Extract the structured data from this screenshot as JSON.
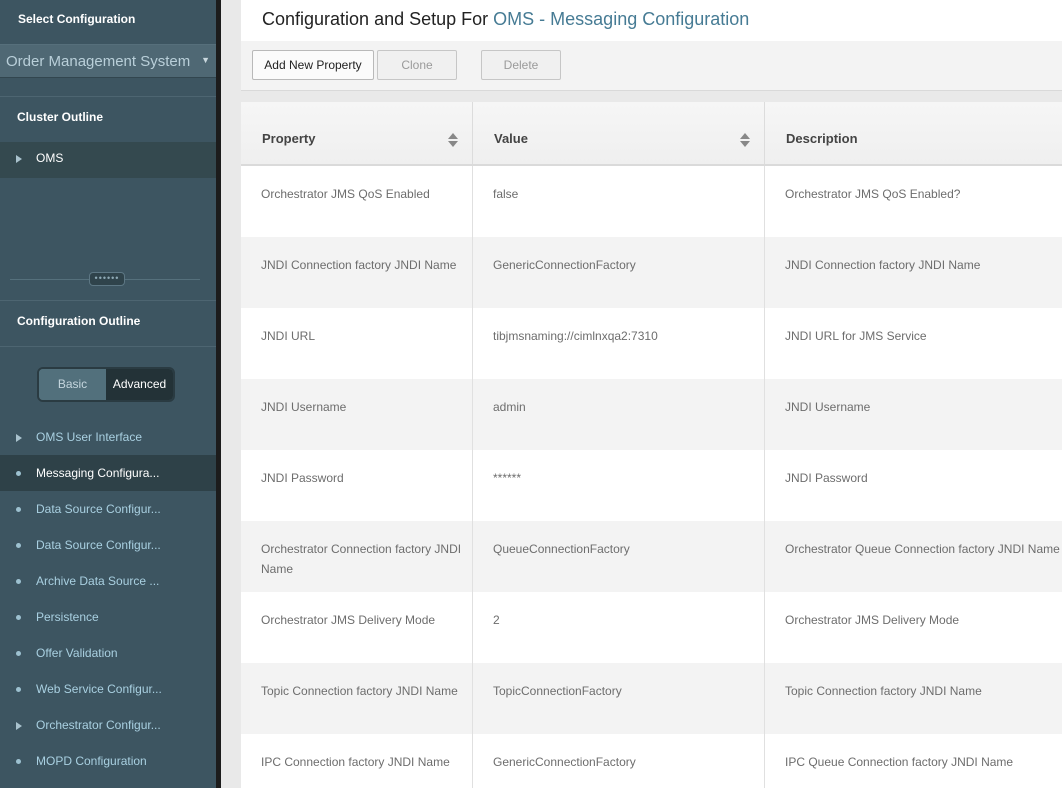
{
  "sidebar": {
    "select_title": "Select Configuration",
    "selected_system": "Order Management System",
    "cluster_title": "Cluster Outline",
    "cluster_item": "OMS",
    "splitter_grip": "••••••",
    "config_title": "Configuration Outline",
    "toggle": {
      "basic": "Basic",
      "advanced": "Advanced"
    },
    "items": [
      {
        "label": "OMS User Interface",
        "marker": "triangle"
      },
      {
        "label": "Messaging Configura...",
        "marker": "dot"
      },
      {
        "label": "Data Source Configur...",
        "marker": "dot"
      },
      {
        "label": "Data Source Configur...",
        "marker": "dot"
      },
      {
        "label": "Archive Data Source ...",
        "marker": "dot"
      },
      {
        "label": "Persistence",
        "marker": "dot"
      },
      {
        "label": "Offer Validation",
        "marker": "dot"
      },
      {
        "label": "Web Service Configur...",
        "marker": "dot"
      },
      {
        "label": "Orchestrator Configur...",
        "marker": "triangle"
      },
      {
        "label": "MOPD Configuration",
        "marker": "dot"
      }
    ]
  },
  "header": {
    "prefix": "Configuration and Setup For",
    "highlight": "OMS - Messaging Configuration"
  },
  "toolbar": {
    "add_label": "Add New Property",
    "clone_label": "Clone",
    "delete_label": "Delete"
  },
  "table": {
    "columns": [
      "Property",
      "Value",
      "Description"
    ],
    "rows": [
      [
        "Orchestrator JMS QoS Enabled",
        "false",
        "Orchestrator JMS QoS Enabled?"
      ],
      [
        "JNDI Connection factory JNDI Name",
        "GenericConnectionFactory",
        "JNDI Connection factory JNDI Name"
      ],
      [
        "JNDI URL",
        "tibjmsnaming://cimlnxqa2:7310",
        "JNDI URL for JMS Service"
      ],
      [
        "JNDI Username",
        "admin",
        "JNDI Username"
      ],
      [
        "JNDI Password",
        "******",
        "JNDI Password"
      ],
      [
        "Orchestrator Connection factory JNDI Name",
        "QueueConnectionFactory",
        "Orchestrator Queue Connection factory JNDI Name"
      ],
      [
        "Orchestrator JMS Delivery Mode",
        "2",
        "Orchestrator JMS Delivery Mode"
      ],
      [
        "Topic Connection factory JNDI Name",
        "TopicConnectionFactory",
        "Topic Connection factory JNDI Name"
      ],
      [
        "IPC Connection factory JNDI Name",
        "GenericConnectionFactory",
        "IPC Queue Connection factory JNDI Name"
      ]
    ]
  },
  "colors": {
    "sidebar_bg": "#3d5561",
    "accent": "#467b94",
    "nav_text": "#a9d0e1"
  }
}
